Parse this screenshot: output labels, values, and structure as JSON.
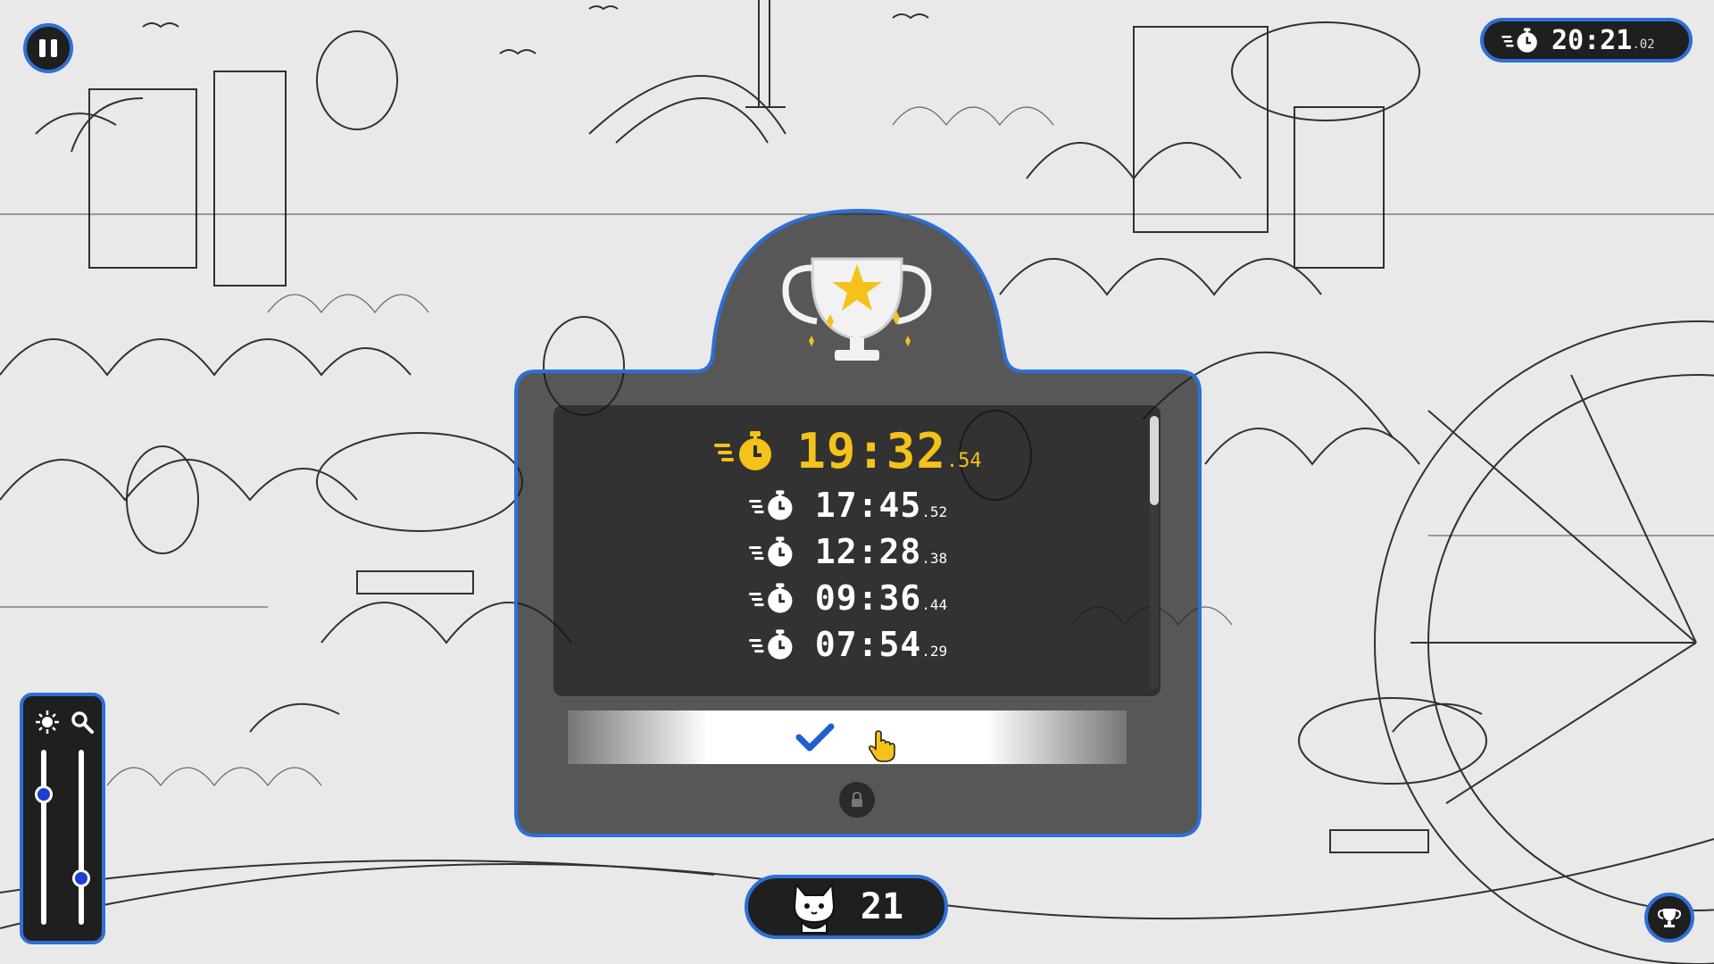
{
  "hud": {
    "timer": {
      "main": "20:21",
      "fraction": ".02"
    },
    "found_count": "21"
  },
  "results": {
    "best": {
      "main": "19:32",
      "fraction": ".54"
    },
    "times": [
      {
        "main": "17:45",
        "fraction": ".52"
      },
      {
        "main": "12:28",
        "fraction": ".38"
      },
      {
        "main": "09:36",
        "fraction": ".44"
      },
      {
        "main": "07:54",
        "fraction": ".29"
      }
    ]
  },
  "sliders": {
    "brightness_level": 0.78,
    "zoom_level": 0.3
  },
  "colors": {
    "accent_blue": "#2f6fd6",
    "gold": "#f4c21a",
    "panel_dark": "#1f1f1f"
  },
  "icons": [
    "pause-icon",
    "stopwatch-icon",
    "trophy-icon",
    "brightness-icon",
    "magnifier-icon",
    "cat-icon",
    "checkmark-icon",
    "hand-cursor-icon"
  ]
}
